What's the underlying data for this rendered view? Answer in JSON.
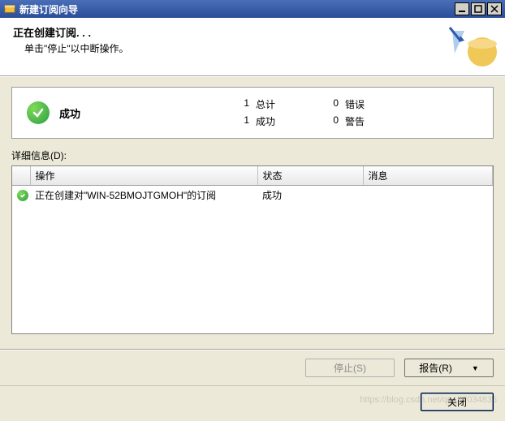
{
  "window": {
    "title": "新建订阅向导"
  },
  "header": {
    "title": "正在创建订阅. . .",
    "subtitle": "单击\"停止\"以中断操作。"
  },
  "summary": {
    "status_label": "成功",
    "total_count": "1",
    "total_label": "总计",
    "success_count": "1",
    "success_label": "成功",
    "error_count": "0",
    "error_label": "错误",
    "warning_count": "0",
    "warning_label": "警告"
  },
  "details": {
    "section_label": "详细信息(D):",
    "columns": {
      "operation": "操作",
      "status": "状态",
      "message": "消息"
    },
    "rows": [
      {
        "icon": "success",
        "operation": "正在创建对\"WIN-52BMOJTGMOH\"的订阅",
        "status": "成功",
        "message": ""
      }
    ]
  },
  "buttons": {
    "stop": "停止(S)",
    "report": "报告(R)",
    "close": "关闭"
  },
  "watermark": "https://blog.csdn.net/qq_37034835"
}
